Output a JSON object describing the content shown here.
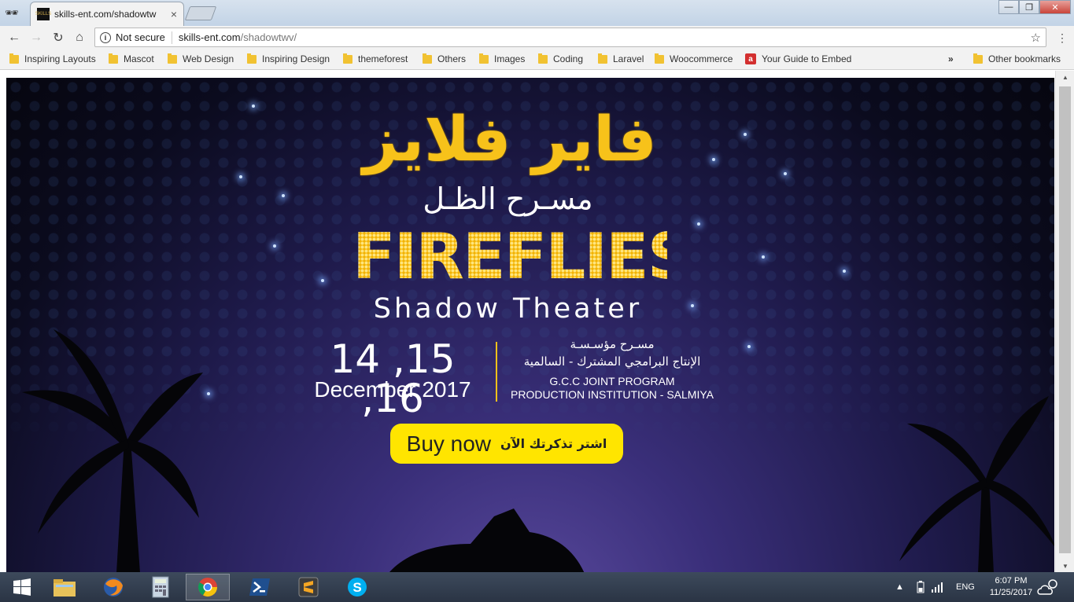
{
  "browser": {
    "tab": {
      "title": "skills-ent.com/shadowtw",
      "favicon_text": "SKILLS"
    },
    "security_label": "Not secure",
    "url_host": "skills-ent.com",
    "url_path": "/shadowtwv/",
    "bookmarks": [
      {
        "label": "Inspiring Layouts",
        "icon": "folder-icon"
      },
      {
        "label": "Mascot",
        "icon": "folder-icon"
      },
      {
        "label": "Web Design",
        "icon": "folder-icon"
      },
      {
        "label": "Inspiring Design",
        "icon": "folder-icon"
      },
      {
        "label": "themeforest",
        "icon": "folder-icon"
      },
      {
        "label": "Others",
        "icon": "folder-icon"
      },
      {
        "label": "Images",
        "icon": "folder-icon"
      },
      {
        "label": "Coding",
        "icon": "folder-icon"
      },
      {
        "label": "Laravel",
        "icon": "folder-icon"
      },
      {
        "label": "Woocommerce",
        "icon": "folder-icon"
      },
      {
        "label": "Your Guide to Embed",
        "icon": "a-icon"
      }
    ],
    "bookmarks_overflow": "»",
    "other_bookmarks": "Other bookmarks"
  },
  "page": {
    "arabic_title": "فاير فلايز",
    "arabic_subtitle": "مسـرح الظـل",
    "title": "FIREFLIES",
    "subtitle": "Shadow Theater",
    "dates": "14 ,15 ,16",
    "month": "December 2017",
    "org_ar_line1": "مسـرح مؤسـسـة",
    "org_ar_line2": "الإنتاج البرامجي المشترك - السالمية",
    "org_en_line1": "G.C.C JOINT PROGRAM",
    "org_en_line2": "PRODUCTION INSTITUTION - SALMIYA",
    "buy_en": "Buy now",
    "buy_ar": "اشتر تذكرتك الآن",
    "accent_color": "#f7c21a",
    "button_color": "#ffe500"
  },
  "taskbar": {
    "apps": [
      "windows-start-icon",
      "file-explorer-icon",
      "firefox-icon",
      "calculator-icon",
      "chrome-icon",
      "powershell-icon",
      "sublime-text-icon",
      "skype-icon"
    ],
    "language": "ENG",
    "time": "6:07 PM",
    "date": "11/25/2017"
  }
}
